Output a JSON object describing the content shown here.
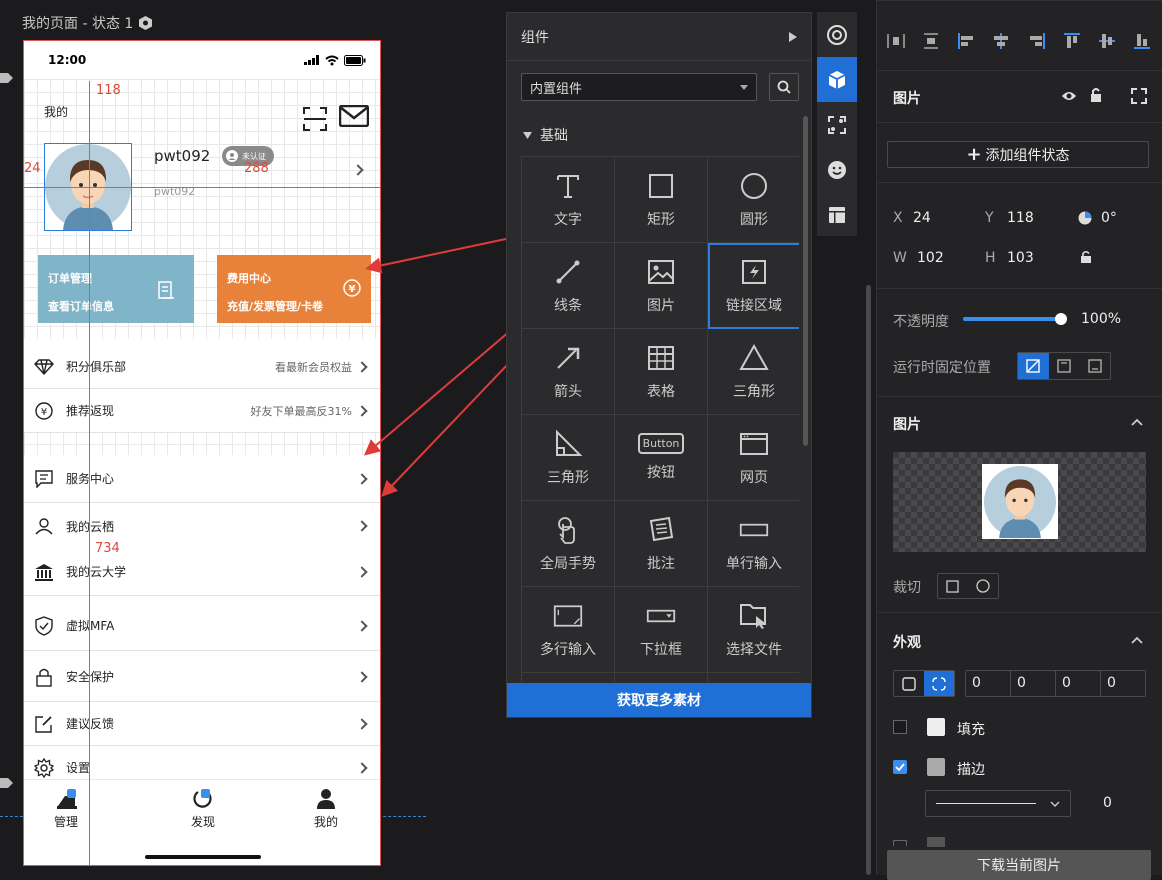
{
  "canvas": {
    "page_title": "我的页面 - 状态 1",
    "measure_top": "118",
    "measure_left": "24",
    "measure_right": "288",
    "measure_bottom": "734"
  },
  "phone": {
    "time": "12:00",
    "header_title": "我的",
    "username": "pwt092",
    "badge": "未认证",
    "user_id": "pwt092",
    "card_orders": {
      "line1": "订单管理",
      "line2": "查看订单信息",
      "color": "#7fb4c9"
    },
    "card_fees": {
      "line1": "费用中心",
      "line2": "充值/发票管理/卡卷",
      "color": "#e8823a"
    },
    "rows": [
      {
        "label": "积分俱乐部",
        "hint": "看最新会员权益",
        "icon": "diamond-icon"
      },
      {
        "label": "推荐返现",
        "hint": "好友下单最高反31%",
        "icon": "yen-icon"
      },
      {
        "label": "服务中心",
        "hint": "",
        "icon": "message-icon"
      },
      {
        "label": "我的云栖",
        "hint": "",
        "icon": "person-icon"
      },
      {
        "label": "我的云大学",
        "hint": "",
        "icon": "bank-icon"
      },
      {
        "label": "虚拟MFA",
        "hint": "",
        "icon": "shield-icon"
      },
      {
        "label": "安全保护",
        "hint": "",
        "icon": "lock-icon"
      },
      {
        "label": "建议反馈",
        "hint": "",
        "icon": "edit-icon"
      },
      {
        "label": "设置",
        "hint": "",
        "icon": "gear-icon"
      }
    ],
    "tabs": [
      {
        "label": "管理"
      },
      {
        "label": "发现"
      },
      {
        "label": "我的"
      }
    ]
  },
  "components": {
    "title": "组件",
    "dropdown": "内置组件",
    "section": "基础",
    "items": [
      {
        "label": "文字",
        "icon": "text-icon"
      },
      {
        "label": "矩形",
        "icon": "rectangle-icon"
      },
      {
        "label": "圆形",
        "icon": "circle-icon"
      },
      {
        "label": "线条",
        "icon": "line-icon"
      },
      {
        "label": "图片",
        "icon": "image-icon"
      },
      {
        "label": "链接区域",
        "icon": "link-area-icon"
      },
      {
        "label": "箭头",
        "icon": "arrow-icon"
      },
      {
        "label": "表格",
        "icon": "table-icon"
      },
      {
        "label": "三角形",
        "icon": "triangle-icon"
      },
      {
        "label": "三角形",
        "icon": "right-triangle-icon"
      },
      {
        "label": "按钮",
        "icon": "button-icon"
      },
      {
        "label": "网页",
        "icon": "webpage-icon"
      },
      {
        "label": "全局手势",
        "icon": "gesture-icon"
      },
      {
        "label": "批注",
        "icon": "annotation-icon"
      },
      {
        "label": "单行输入",
        "icon": "input-icon"
      },
      {
        "label": "多行输入",
        "icon": "textarea-icon"
      },
      {
        "label": "下拉框",
        "icon": "dropdown-icon"
      },
      {
        "label": "选择文件",
        "icon": "file-icon"
      }
    ],
    "button_glyph": "Button",
    "more_button": "获取更多素材"
  },
  "props": {
    "header_title": "图片",
    "add_state": "添加组件状态",
    "x_label": "X",
    "x": "24",
    "y_label": "Y",
    "y": "118",
    "rotation": "0°",
    "w_label": "W",
    "w": "102",
    "h_label": "H",
    "h": "103",
    "opacity_label": "不透明度",
    "opacity_value": "100%",
    "opacity": 1.0,
    "fixed_label": "运行时固定位置",
    "image_section": "图片",
    "crop_label": "裁切",
    "appearance_section": "外观",
    "radius_values": [
      "0",
      "0",
      "0",
      "0"
    ],
    "fill_label": "填充",
    "stroke_label": "描边",
    "stroke_width": "0",
    "download_button": "下载当前图片"
  }
}
